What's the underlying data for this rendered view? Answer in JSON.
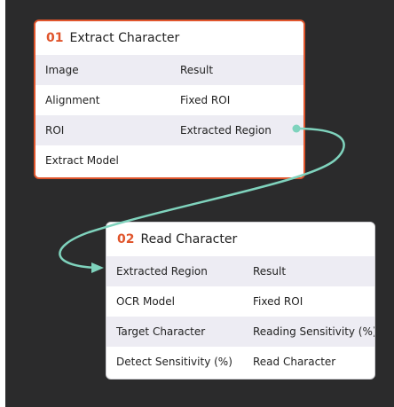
{
  "colors": {
    "workspace_bg": "#2b2b2c",
    "accent": "#e0552c",
    "link": "#7fd3bd",
    "row_shade": "#edecf3"
  },
  "nodes": {
    "extract": {
      "number": "01",
      "title": "Extract Character",
      "rows": [
        {
          "input": "Image",
          "output": "Result"
        },
        {
          "input": "Alignment",
          "output": "Fixed ROI"
        },
        {
          "input": "ROI",
          "output": "Extracted Region"
        },
        {
          "input": "Extract Model",
          "output": ""
        }
      ]
    },
    "read": {
      "number": "02",
      "title": "Read Character",
      "rows": [
        {
          "input": "Extracted Region",
          "output": "Result"
        },
        {
          "input": "OCR Model",
          "output": "Fixed ROI"
        },
        {
          "input": "Target Character",
          "output": "Reading Sensitivity (%)"
        },
        {
          "input": "Detect Sensitivity (%)",
          "output": "Read Character"
        }
      ]
    }
  }
}
